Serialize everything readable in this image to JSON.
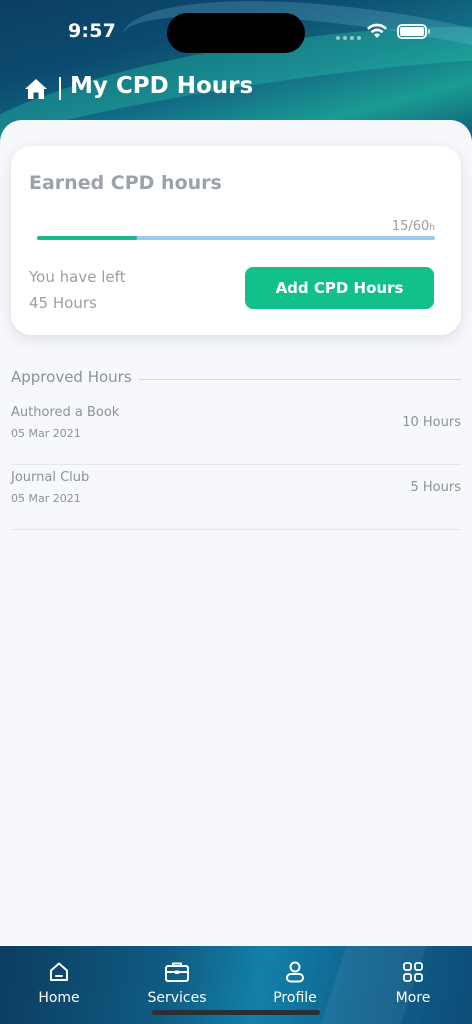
{
  "status_bar": {
    "time": "9:57"
  },
  "header": {
    "title": "My CPD Hours",
    "home_icon": "home-icon"
  },
  "summary": {
    "title": "Earned CPD hours",
    "progress_value": "15/60",
    "progress_unit": "h",
    "progress_fraction": 0.25,
    "left_label": "You have left",
    "left_value": "45 Hours",
    "add_button_label": "Add CPD Hours"
  },
  "approved": {
    "section_title": "Approved Hours",
    "items": [
      {
        "title": "Authored a Book",
        "date": "05 Mar 2021",
        "hours": "10 Hours"
      },
      {
        "title": "Journal Club",
        "date": "05 Mar 2021",
        "hours": "5 Hours"
      }
    ]
  },
  "nav": {
    "items": [
      {
        "label": "Home",
        "icon": "home-outline-icon"
      },
      {
        "label": "Services",
        "icon": "briefcase-icon"
      },
      {
        "label": "Profile",
        "icon": "user-icon"
      },
      {
        "label": "More",
        "icon": "grid-icon"
      }
    ]
  },
  "colors": {
    "accent_green": "#12c08c",
    "progress_track": "#98c9f0",
    "header_dark": "#0b3f63"
  }
}
